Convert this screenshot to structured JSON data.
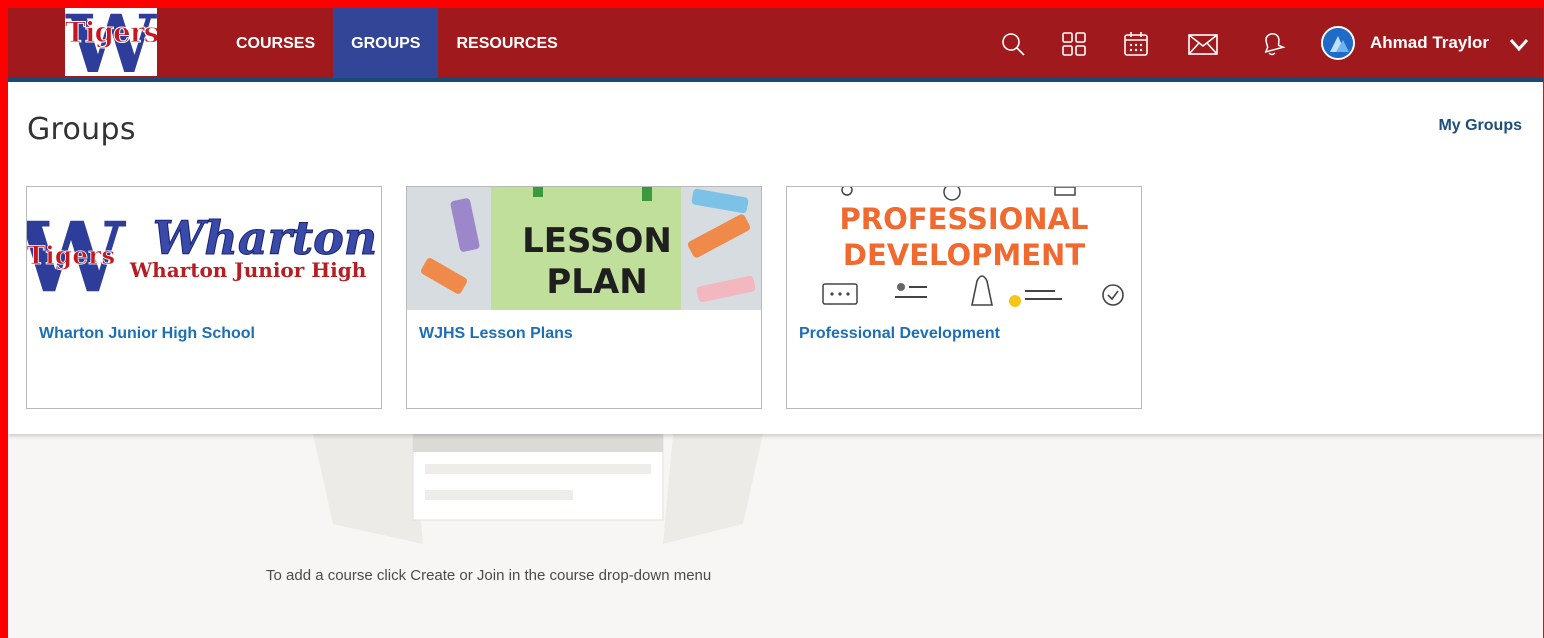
{
  "header": {
    "logo": {
      "letter": "W",
      "text": "Tigers"
    },
    "nav": [
      {
        "label": "COURSES",
        "active": false
      },
      {
        "label": "GROUPS",
        "active": true
      },
      {
        "label": "RESOURCES",
        "active": false
      }
    ],
    "icons": [
      "search-icon",
      "apps-grid-icon",
      "calendar-icon",
      "mail-icon",
      "bell-icon"
    ],
    "user": {
      "name": "Ahmad Traylor"
    },
    "colors": {
      "nav_bg": "#a0191d",
      "active_tab": "#334597",
      "stripe": "#174b78"
    }
  },
  "groups_panel": {
    "title": "Groups",
    "my_groups_link": "My Groups",
    "cards": [
      {
        "title": "Wharton Junior High School",
        "image_text_1": "Wharton",
        "image_text_2": "Wharton Junior High",
        "image_text_3": "Tigers"
      },
      {
        "title": "WJHS Lesson Plans",
        "image_text_1": "LESSON",
        "image_text_2": "PLAN"
      },
      {
        "title": "Professional Development",
        "image_text_1": "PROFESSIONAL",
        "image_text_2": "DEVELOPMENT"
      }
    ]
  },
  "empty_state": {
    "message": "To add a course click Create or Join in the course drop-down menu"
  }
}
